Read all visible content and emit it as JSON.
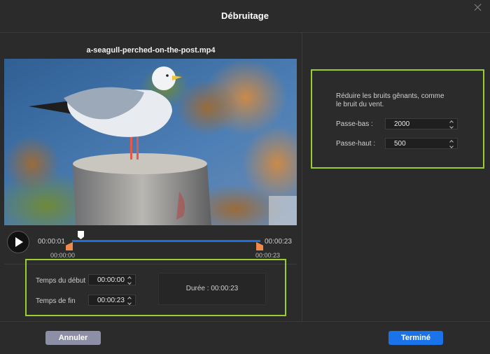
{
  "dialog": {
    "title": "Débruitage"
  },
  "video": {
    "filename": "a-seagull-perched-on-the-post.mp4"
  },
  "player": {
    "current_time": "00:00:01",
    "total_time": "00:00:23",
    "range_start": "00:00:00",
    "range_end": "00:00:23"
  },
  "trim": {
    "start_label": "Temps du début",
    "start_value": "00:00:00",
    "end_label": "Temps de fin",
    "end_value": "00:00:23",
    "duration_text": "Durée : 00:00:23"
  },
  "noise": {
    "description": "Réduire les bruits gênants, comme le bruit du vent.",
    "lowpass_label": "Passe-bas :",
    "lowpass_value": "2000",
    "highpass_label": "Passe-haut :",
    "highpass_value": "500"
  },
  "buttons": {
    "cancel": "Annuler",
    "done": "Terminé"
  },
  "colors": {
    "accent": "#1a73e8",
    "trim_handle": "#f08a4b",
    "highlight": "#9acd32"
  }
}
